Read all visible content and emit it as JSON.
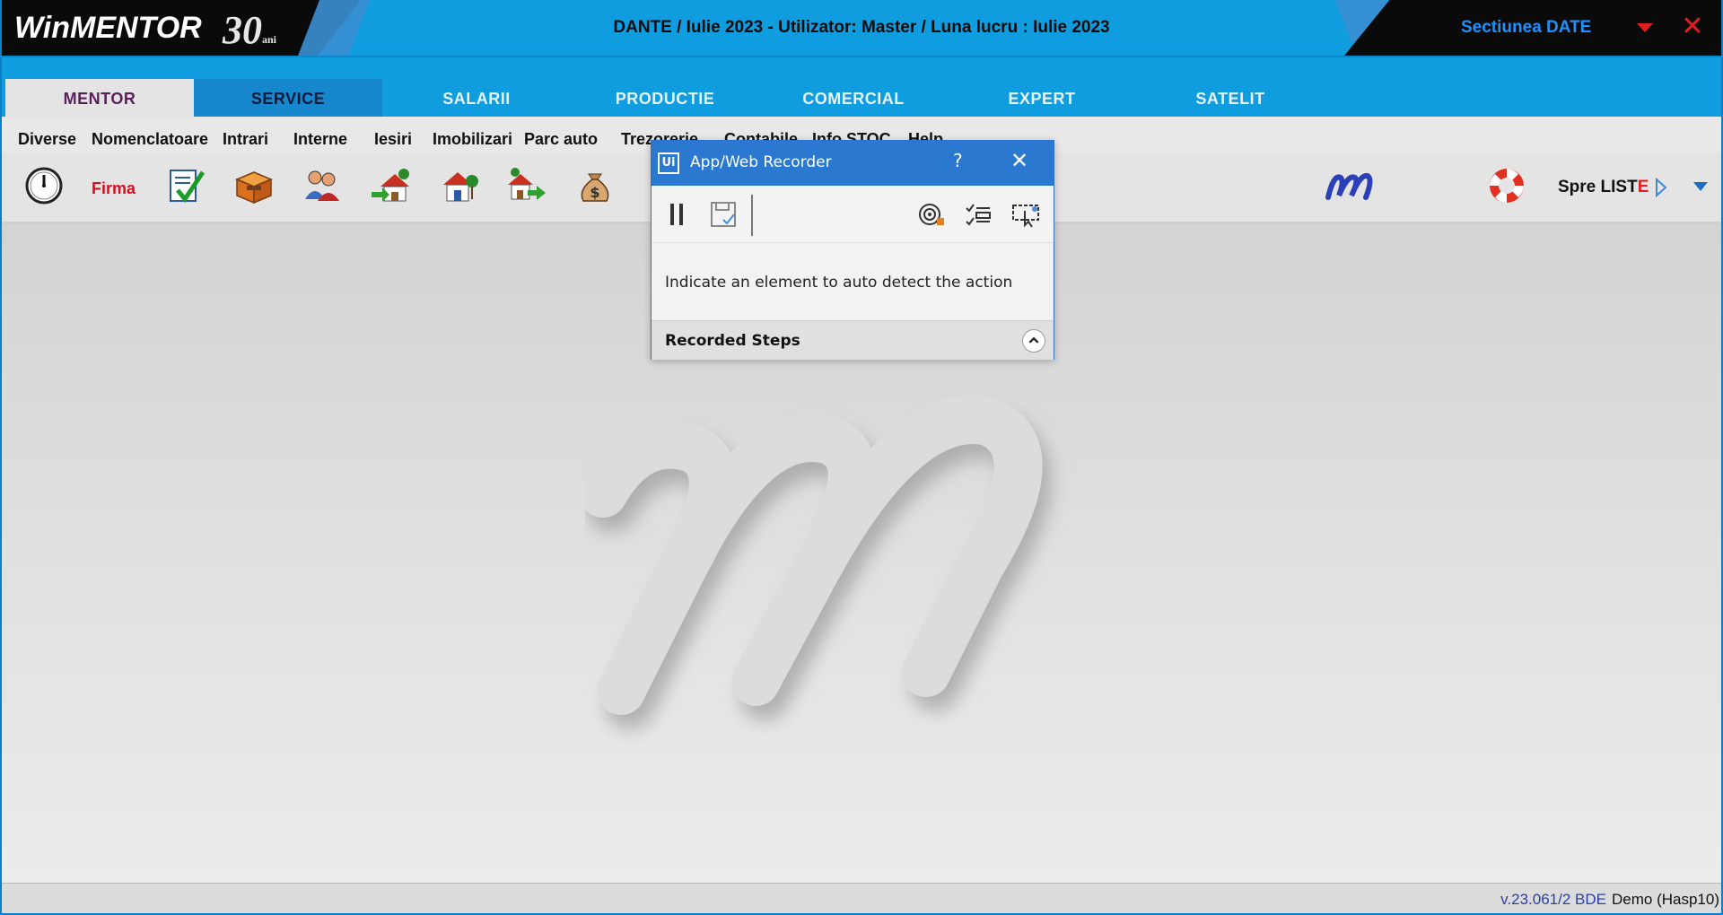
{
  "window": {
    "logo_text": "WinMENTOR",
    "logo_badge": "30",
    "logo_badge_sub": "ani",
    "title": "DANTE / Iulie 2023 - Utilizator: Master / Luna lucru : Iulie 2023",
    "section": "Sectiunea DATE",
    "close_glyph": "✕"
  },
  "modules": [
    "MENTOR",
    "SERVICE",
    "SALARII",
    "PRODUCTIE",
    "COMERCIAL",
    "EXPERT",
    "SATELIT"
  ],
  "menu": [
    "Diverse",
    "Nomenclatoare",
    "Intrari",
    "Interne",
    "Iesiri",
    "Imobilizari",
    "Parc auto",
    "Trezorerie",
    "Contabile",
    "Info STOC",
    "Help"
  ],
  "toolbar": {
    "firma_label": "Firma",
    "spre_label": "Spre LIST",
    "spre_accent": "E"
  },
  "status": {
    "version": "v.23.061/2 BDE",
    "license": "Demo (Hasp10)"
  },
  "recorder": {
    "logo": "Ui",
    "title": "App/Web Recorder",
    "help": "?",
    "close": "✕",
    "message": "Indicate an element to auto detect the action",
    "steps_label": "Recorded Steps"
  },
  "colors": {
    "titlebar_blue": "#0f9de0",
    "recorder_blue": "#2b78d0",
    "accent_red": "#e02020",
    "section_blue": "#1e90ff"
  }
}
